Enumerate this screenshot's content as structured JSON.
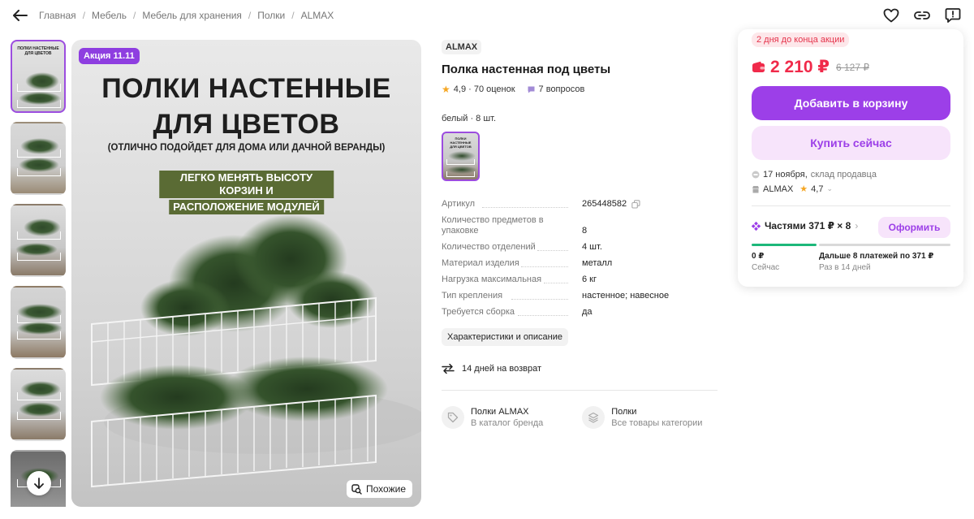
{
  "breadcrumb": [
    "Главная",
    "Мебель",
    "Мебель для хранения",
    "Полки",
    "ALMAX"
  ],
  "gallery": {
    "thumbs_count": 6,
    "thumb_title": "ПОЛКИ НАСТЕННЫЕ ДЛЯ ЦВЕТОВ",
    "badge": "Акция 11.11",
    "title_line1": "ПОЛКИ НАСТЕННЫЕ",
    "title_line2": "ДЛЯ ЦВЕТОВ",
    "subtitle": "(ОТЛИЧНО ПОДОЙДЕТ ДЛЯ ДОМА ИЛИ ДАЧНОЙ ВЕРАНДЫ)",
    "highlight_line1": "ЛЕГКО МЕНЯТЬ ВЫСОТУ КОРЗИН И",
    "highlight_line2": "РАСПОЛОЖЕНИЕ МОДУЛЕЙ",
    "similar_label": "Похожие"
  },
  "product": {
    "brand": "ALMAX",
    "title": "Полка настенная под цветы",
    "rating": "4,9 · 70 оценок",
    "questions": "7 вопросов",
    "variant": "белый · 8 шт.",
    "variant_thumb_title": "ПОЛКИ НАСТЕННЫЕ ДЛЯ ЦВЕТОВ",
    "specs": [
      {
        "k": "Артикул",
        "v": "265448582"
      },
      {
        "k": "Количество предметов в упаковке",
        "v": "8"
      },
      {
        "k": "Количество отделений",
        "v": "4 шт."
      },
      {
        "k": "Материал изделия",
        "v": "металл"
      },
      {
        "k": "Нагрузка максимальная",
        "v": "6 кг"
      },
      {
        "k": "Тип крепления",
        "v": "настенное; навесное"
      },
      {
        "k": "Требуется сборка",
        "v": "да"
      }
    ],
    "characteristics_button": "Характеристики и описание",
    "return_text": "14 дней на возврат",
    "link_brand": {
      "t1": "Полки ALMAX",
      "t2": "В каталог бренда"
    },
    "link_category": {
      "t1": "Полки",
      "t2": "Все товары категории"
    }
  },
  "buybox": {
    "deal": "2 дня до конца акции",
    "price": "2 210 ₽",
    "old_price": "6 127 ₽",
    "cart_button": "Добавить в корзину",
    "buy_button": "Купить сейчас",
    "delivery_date": "17 ноября,",
    "delivery_source": "склад продавца",
    "seller": "ALMAX",
    "seller_rating": "4,7",
    "parts": "Частями 371 ₽ × 8",
    "order_button": "Оформить",
    "pay_now_amount": "0 ₽",
    "pay_now_label": "Сейчас",
    "pay_later_amount": "Дальше 8 платежей по 371 ₽",
    "pay_later_label": "Раз в 14 дней"
  },
  "colors": {
    "accent": "#9c3fe8",
    "price": "#f02a4a",
    "installment_bar": "#1db87a"
  }
}
